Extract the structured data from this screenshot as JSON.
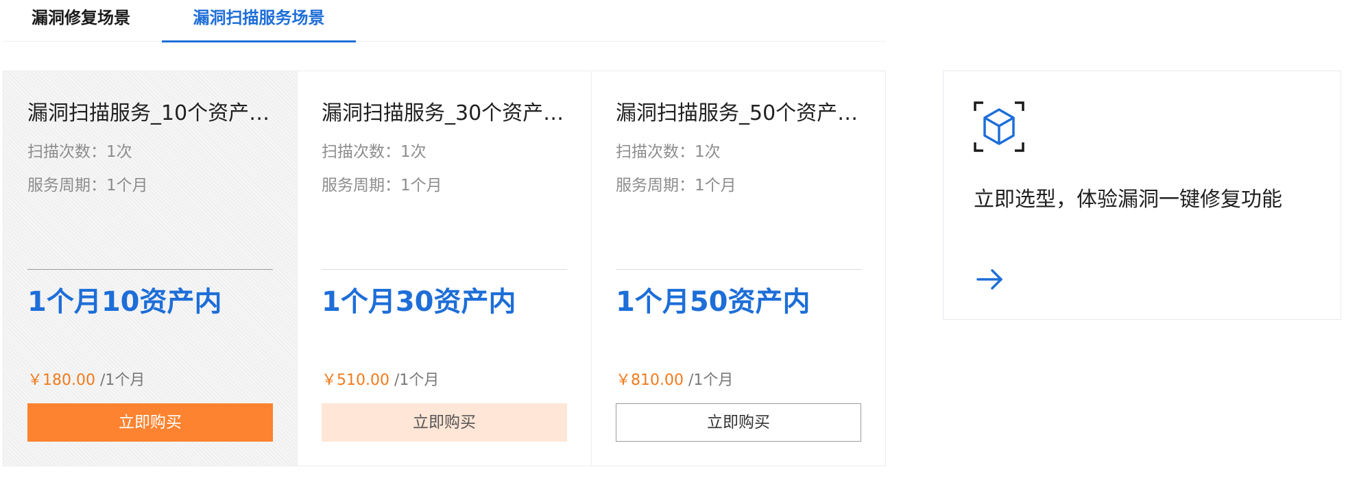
{
  "tabs": [
    {
      "label": "漏洞修复场景"
    },
    {
      "label": "漏洞扫描服务场景"
    }
  ],
  "products": [
    {
      "title": "漏洞扫描服务_10个资产…",
      "scan_count": "扫描次数：1次",
      "service_period": "服务周期：1个月",
      "plan": "1个月10资产内",
      "price": "￥180.00",
      "price_unit": "/1个月",
      "buy_label": "立即购买"
    },
    {
      "title": "漏洞扫描服务_30个资产…",
      "scan_count": "扫描次数：1次",
      "service_period": "服务周期：1个月",
      "plan": "1个月30资产内",
      "price": "￥510.00",
      "price_unit": "/1个月",
      "buy_label": "立即购买"
    },
    {
      "title": "漏洞扫描服务_50个资产…",
      "scan_count": "扫描次数：1次",
      "service_period": "服务周期：1个月",
      "plan": "1个月50资产内",
      "price": "￥810.00",
      "price_unit": "/1个月",
      "buy_label": "立即购买"
    }
  ],
  "promo": {
    "text": "立即选型，体验漏洞一键修复功能",
    "icon": "cube-scan-icon",
    "arrow_icon": "arrow-right-icon"
  },
  "colors": {
    "accent_blue": "#1d6ed8",
    "price_orange": "#f07a1c",
    "button_orange": "#fd8330",
    "button_soft": "#ffe6d6"
  }
}
